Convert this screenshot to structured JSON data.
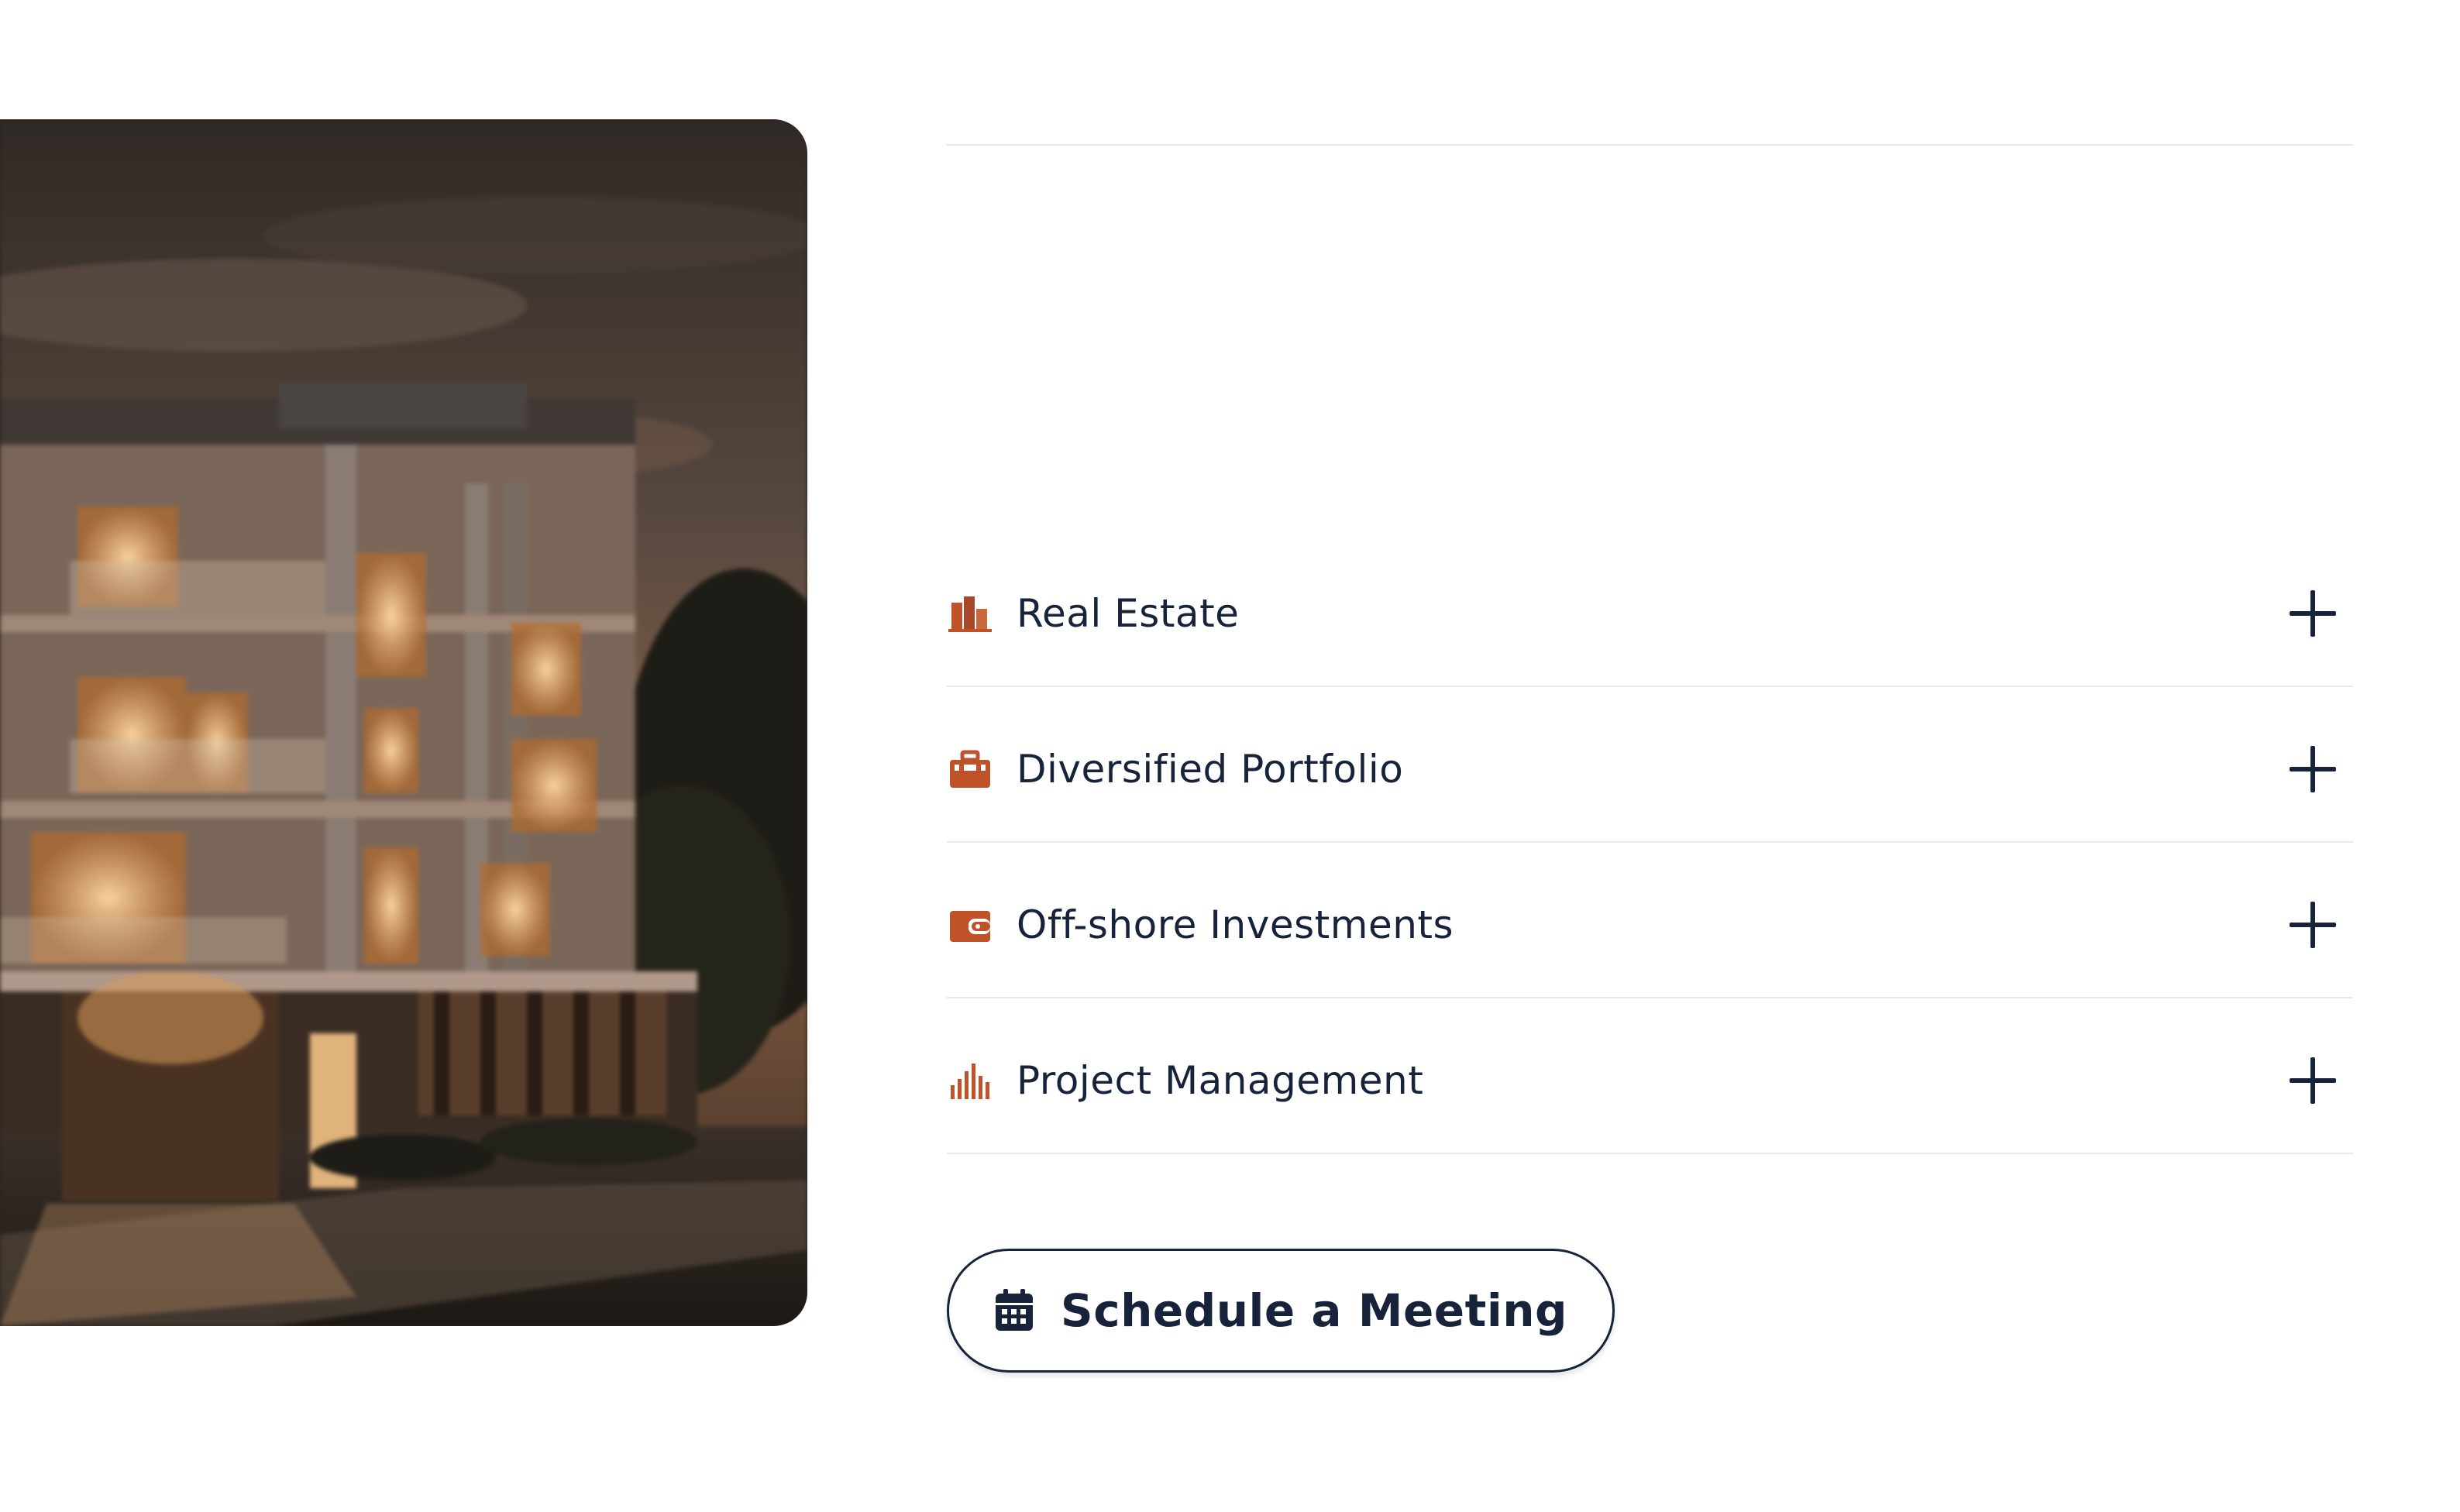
{
  "image": {
    "alt_icon": "building-photo"
  },
  "accordion": {
    "items": [
      {
        "label": "Real Estate",
        "icon": "buildings-icon"
      },
      {
        "label": "Diversified Portfolio",
        "icon": "briefcase-icon"
      },
      {
        "label": "Off-shore Investments",
        "icon": "wallet-icon"
      },
      {
        "label": "Project Management",
        "icon": "bar-chart-icon"
      }
    ],
    "expand_icon": "plus-icon"
  },
  "cta": {
    "label": "Schedule a Meeting",
    "icon": "calendar-icon"
  },
  "colors": {
    "text": "#16233a",
    "accent": "#c0522a",
    "divider": "#e6e8ec"
  }
}
